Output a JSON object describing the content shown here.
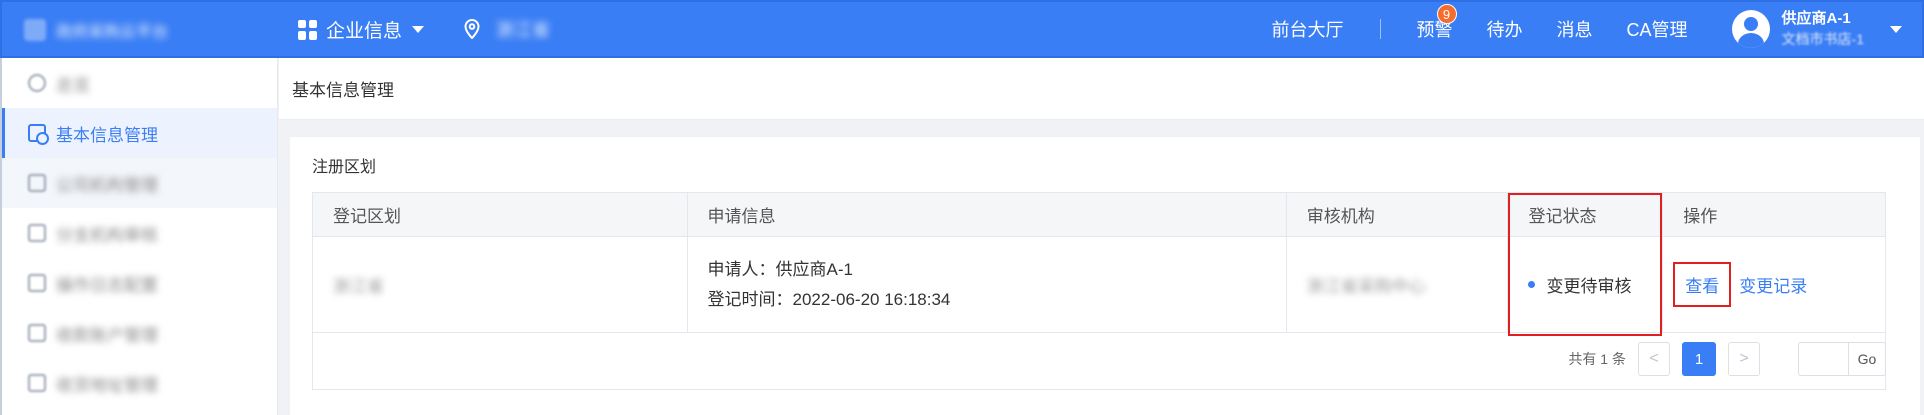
{
  "app": {
    "logo_text": "政府采购云平台",
    "logo_icon": "platform-logo-icon"
  },
  "topbar": {
    "company_menu": "企业信息",
    "location": "浙江省",
    "links": {
      "front_hall": "前台大厅",
      "warning": "预警",
      "warning_badge": "9",
      "todo": "待办",
      "messages": "消息",
      "ca": "CA管理"
    },
    "user": {
      "name": "供应商A-1",
      "org": "文档市书店-1"
    },
    "colors": {
      "primary": "#3a7ef5",
      "badge": "#f56c2c"
    }
  },
  "sidebar": {
    "items": [
      {
        "label": "总览",
        "blurred": true
      },
      {
        "label": "基本信息管理",
        "active": true
      },
      {
        "label": "公司机构管理",
        "blurred": true
      },
      {
        "label": "分支机构审核",
        "blurred": true
      },
      {
        "label": "操作日志配置",
        "blurred": true
      },
      {
        "label": "收款账户管理",
        "blurred": true
      },
      {
        "label": "收货地址管理",
        "blurred": true
      }
    ]
  },
  "breadcrumb": "基本信息管理",
  "section": {
    "title": "注册区划",
    "table": {
      "headers": [
        "登记区划",
        "申请信息",
        "审核机构",
        "登记状态",
        "操作"
      ],
      "rows": [
        {
          "region": "浙江省",
          "applicant": "申请人：供应商A-1",
          "register_time": "登记时间：2022-06-20 16:18:34",
          "reviewer": "浙江省采购中心",
          "status": "变更待审核",
          "actions": {
            "view": "查看",
            "history": "变更记录"
          }
        }
      ]
    },
    "pagination": {
      "total": "共有 1 条",
      "prev": "<",
      "current": "1",
      "next": ">",
      "jump_value": "",
      "go": "Go"
    }
  },
  "highlight_color": "#e02020"
}
